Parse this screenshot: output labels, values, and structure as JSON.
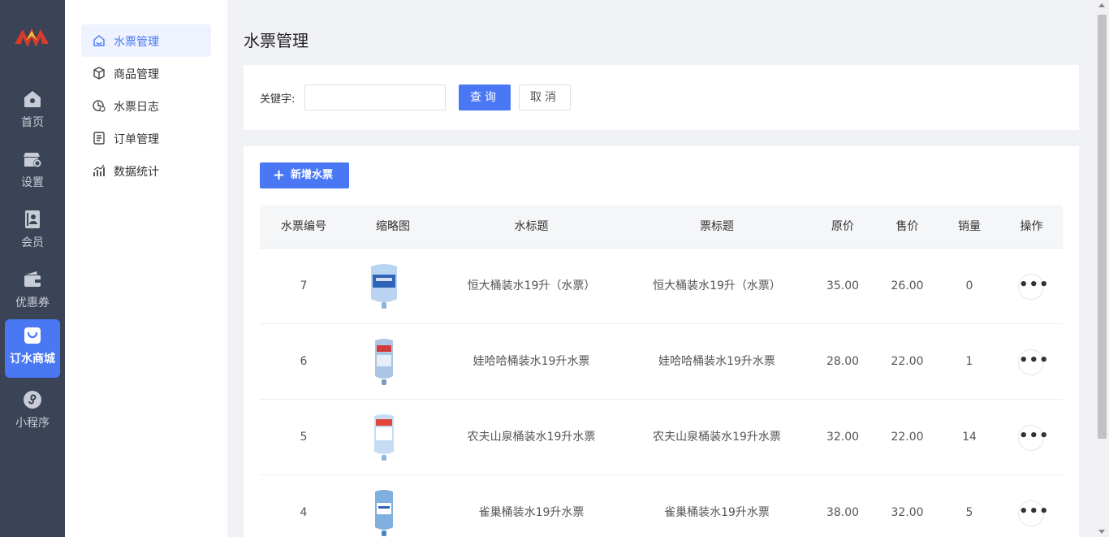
{
  "rail": {
    "items": [
      {
        "label": "首页",
        "icon": "home-icon"
      },
      {
        "label": "设置",
        "icon": "store-settings-icon"
      },
      {
        "label": "会员",
        "icon": "member-card-icon"
      },
      {
        "label": "优惠券",
        "icon": "wallet-icon"
      },
      {
        "label": "订水商城",
        "icon": "shopping-bag-icon"
      },
      {
        "label": "小程序",
        "icon": "mini-program-icon"
      }
    ],
    "active_index": 4
  },
  "submenu": {
    "items": [
      {
        "label": "水票管理",
        "icon": "ticket-icon"
      },
      {
        "label": "商品管理",
        "icon": "box-icon"
      },
      {
        "label": "水票日志",
        "icon": "clock-log-icon"
      },
      {
        "label": "订单管理",
        "icon": "order-list-icon"
      },
      {
        "label": "数据统计",
        "icon": "stats-chart-icon"
      }
    ],
    "active_index": 0
  },
  "page": {
    "title": "水票管理"
  },
  "search": {
    "label": "关键字:",
    "value": "",
    "placeholder": "",
    "query_label": "查询",
    "cancel_label": "取消"
  },
  "toolbar": {
    "add_label": "新增水票"
  },
  "table": {
    "columns": [
      "水票编号",
      "缩略图",
      "水标题",
      "票标题",
      "原价",
      "售价",
      "销量",
      "操作"
    ],
    "rows": [
      {
        "id": "7",
        "water_title": "恒大桶装水19升（水票）",
        "ticket_title": "恒大桶装水19升（水票）",
        "original_price": "35.00",
        "sale_price": "26.00",
        "sales": "0",
        "action": "•••"
      },
      {
        "id": "6",
        "water_title": "娃哈哈桶装水19升水票",
        "ticket_title": "娃哈哈桶装水19升水票",
        "original_price": "28.00",
        "sale_price": "22.00",
        "sales": "1",
        "action": "•••"
      },
      {
        "id": "5",
        "water_title": "农夫山泉桶装水19升水票",
        "ticket_title": "农夫山泉桶装水19升水票",
        "original_price": "32.00",
        "sale_price": "22.00",
        "sales": "14",
        "action": "•••"
      },
      {
        "id": "4",
        "water_title": "雀巢桶装水19升水票",
        "ticket_title": "雀巢桶装水19升水票",
        "original_price": "38.00",
        "sale_price": "32.00",
        "sales": "5",
        "action": "•••"
      }
    ]
  },
  "colors": {
    "primary": "#4a78f5",
    "rail_bg": "#3b4356"
  }
}
